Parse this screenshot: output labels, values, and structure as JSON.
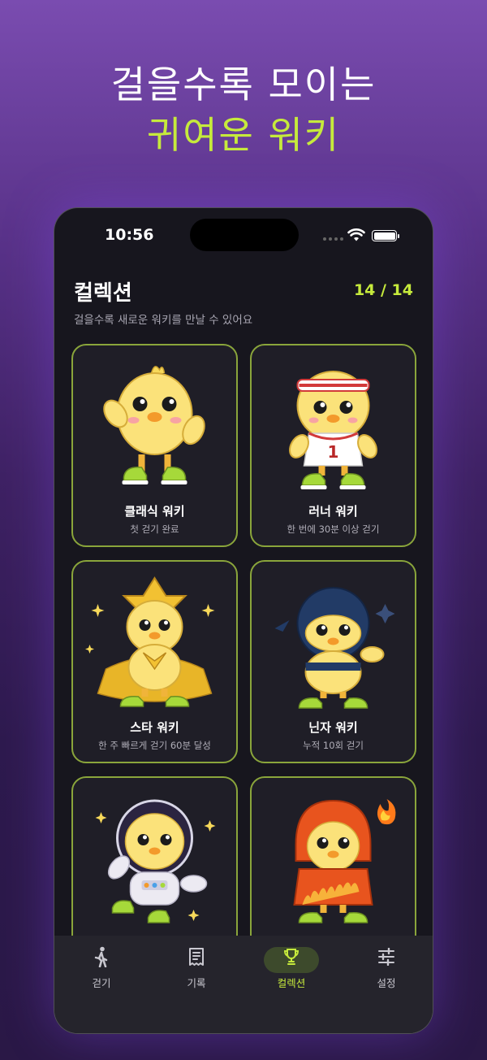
{
  "promo": {
    "line1": "걸을수록 모이는",
    "line2": "귀여운 워키"
  },
  "status_bar": {
    "time": "10:56"
  },
  "header": {
    "title": "컬렉션",
    "count": "14 / 14",
    "subtitle": "걸을수록 새로운 워키를 만날 수 있어요"
  },
  "cards": [
    {
      "name": "클래식 워키",
      "condition": "첫 걷기 완료",
      "character": "classic-chick"
    },
    {
      "name": "러너 워키",
      "condition": "한 번에 30분 이상 걷기",
      "character": "runner-chick",
      "jersey_number": "1"
    },
    {
      "name": "스타 워키",
      "condition": "한 주 빠르게 걷기 60분 달성",
      "character": "star-chick"
    },
    {
      "name": "닌자 워키",
      "condition": "누적 10회 걷기",
      "character": "ninja-chick"
    },
    {
      "name": "",
      "condition": "",
      "character": "astronaut-chick"
    },
    {
      "name": "",
      "condition": "",
      "character": "fire-hoodie-chick"
    }
  ],
  "tabbar": {
    "items": [
      {
        "label": "걷기",
        "icon": "walking-icon"
      },
      {
        "label": "기록",
        "icon": "receipt-icon"
      },
      {
        "label": "컬렉션",
        "icon": "trophy-icon",
        "active": true
      },
      {
        "label": "설정",
        "icon": "sliders-icon"
      }
    ]
  },
  "colors": {
    "accent": "#c6ea3c",
    "card_border": "#8aa53b",
    "phone_bg": "#17161e",
    "card_bg": "#1f1e27"
  }
}
